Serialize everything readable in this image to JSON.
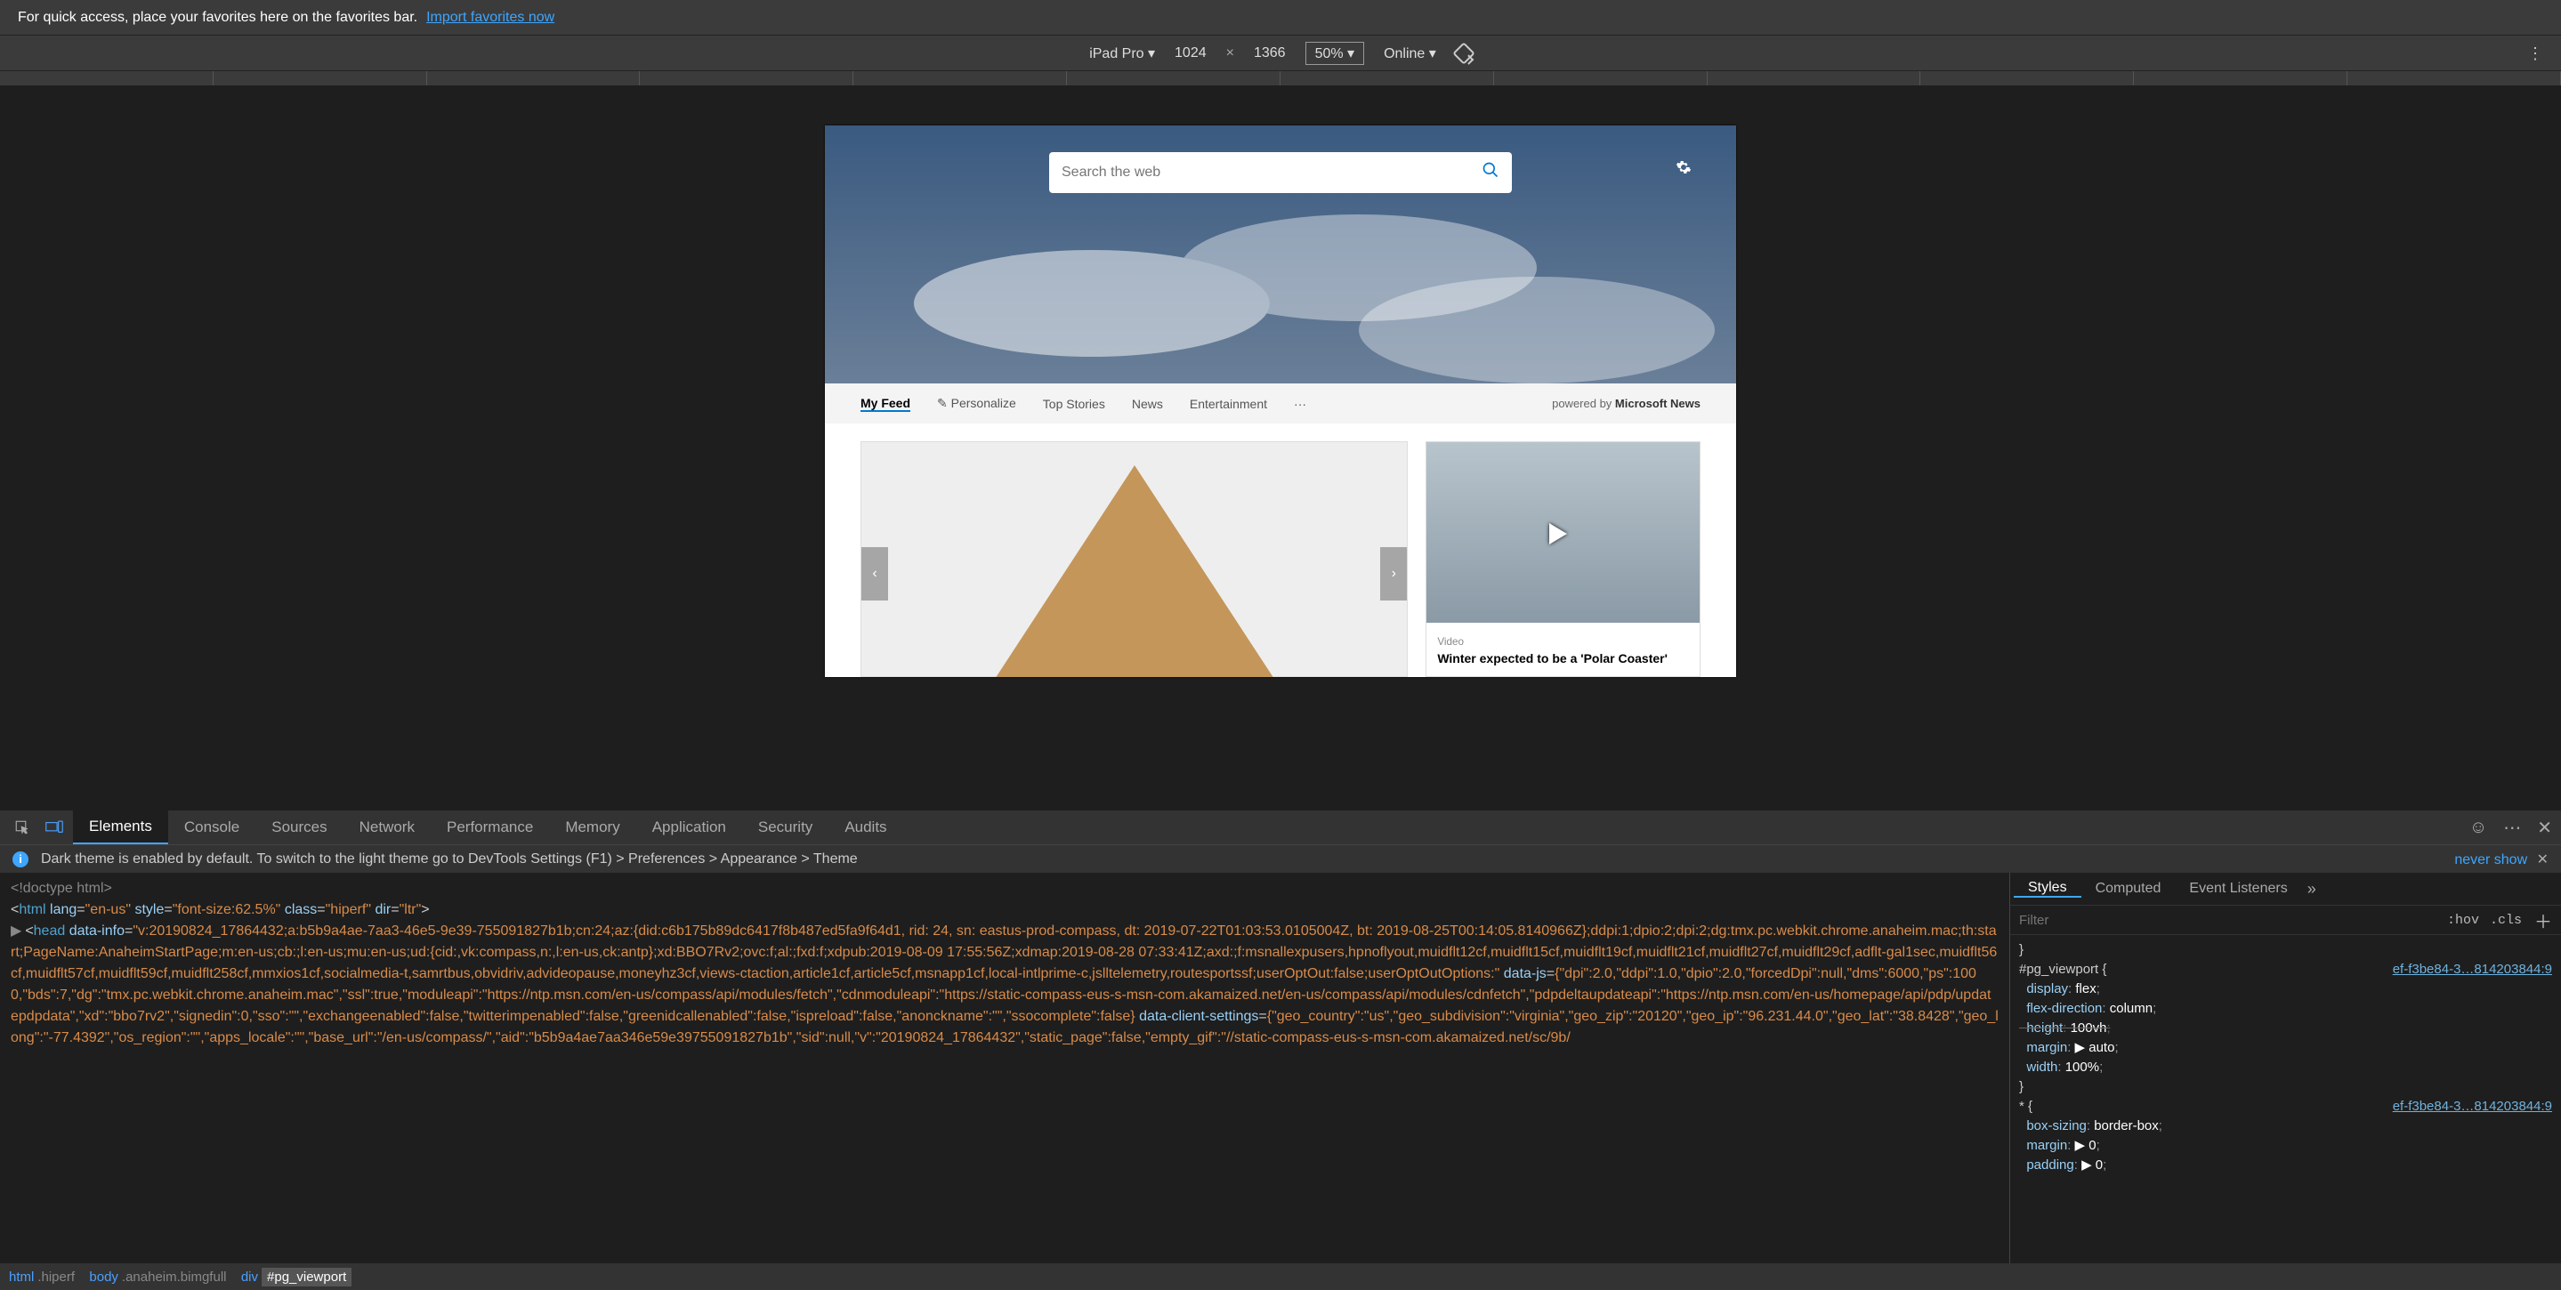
{
  "favorites": {
    "text": "For quick access, place your favorites here on the favorites bar.",
    "link": "Import favorites now"
  },
  "device_toolbar": {
    "device": "iPad Pro ▾",
    "width": "1024",
    "x": "×",
    "height": "1366",
    "zoom": "50% ▾",
    "network": "Online ▾"
  },
  "simulated_page": {
    "search_placeholder": "Search the web",
    "feed_tabs": [
      "My Feed",
      "✎ Personalize",
      "Top Stories",
      "News",
      "Entertainment",
      "···"
    ],
    "powered_by": "powered by ",
    "powered_by_brand": "Microsoft News",
    "video_label": "Video",
    "video_title": "Winter expected to be a 'Polar Coaster'"
  },
  "devtools": {
    "tabs": [
      "Elements",
      "Console",
      "Sources",
      "Network",
      "Performance",
      "Memory",
      "Application",
      "Security",
      "Audits"
    ],
    "info_text": "Dark theme is enabled by default. To switch to the light theme go to DevTools Settings (F1) > Preferences > Appearance > Theme",
    "never_show": "never show",
    "styles_tabs": [
      "Styles",
      "Computed",
      "Event Listeners"
    ],
    "filter_placeholder": "Filter",
    "hov": ":hov",
    "cls": ".cls",
    "rule1_selector": "#pg_viewport {",
    "rule1_source": "ef-f3be84-3…814203844:9",
    "rule1_props": [
      {
        "p": "display",
        "v": "flex"
      },
      {
        "p": "flex-direction",
        "v": "column"
      },
      {
        "p": "height",
        "v": "100vh",
        "strike": true
      },
      {
        "p": "margin",
        "v": "▶ auto",
        "tri": true
      },
      {
        "p": "width",
        "v": "100%"
      }
    ],
    "rule2_selector": "* {",
    "rule2_source": "ef-f3be84-3…814203844:9",
    "rule2_props": [
      {
        "p": "box-sizing",
        "v": "border-box"
      },
      {
        "p": "margin",
        "v": "▶ 0",
        "tri": true
      },
      {
        "p": "padding",
        "v": "▶ 0",
        "tri": true
      }
    ],
    "breadcrumbs": [
      {
        "main": "html",
        "sub": ".hiperf"
      },
      {
        "main": "body",
        "sub": ".anaheim.bimgfull"
      },
      {
        "main": "div",
        "sub": "#pg_viewport",
        "cur": true
      }
    ],
    "dom_lines": {
      "doctype": "<!doctype html>",
      "html_open": "<html lang=\"en-us\" style=\"font-size:62.5%\" class=\"hiperf\" dir=\"ltr\">",
      "head_open_attr": "data-info",
      "data_info_val": "\"v:20190824_17864432;a:b5b9a4ae-7aa3-46e5-9e39-755091827b1b;cn:24;az:{did:c6b175b89dc6417f8b487ed5fa9f64d1, rid: 24, sn: eastus-prod-compass, dt: 2019-07-22T01:03:53.0105004Z, bt: 2019-08-25T00:14:05.8140966Z};ddpi:1;dpio:2;dpi:2;dg:tmx.pc.webkit.chrome.anaheim.mac;th:start;PageName:AnaheimStartPage;m:en-us;cb:;l:en-us;mu:en-us;ud:{cid:,vk:compass,n:,l:en-us,ck:antp};xd:BBO7Rv2;ovc:f;al:;fxd:f;xdpub:2019-08-09 17:55:56Z;xdmap:2019-08-28 07:33:41Z;axd:;f:msnallexpusers,hpnoflyout,muidflt12cf,muidflt15cf,muidflt19cf,muidflt21cf,muidflt27cf,muidflt29cf,adflt-gal1sec,muidflt56cf,muidflt57cf,muidflt59cf,muidflt258cf,mmxios1cf,socialmedia-t,samrtbus,obvidriv,advideopause,moneyhz3cf,views-ctaction,article1cf,article5cf,msnapp1cf,local-intlprime-c,jslltelemetry,routesportssf;userOptOut:false;userOptOutOptions:\"",
      "data_js_attr": "data-js",
      "data_js_val": "{\"dpi\":2.0,\"ddpi\":1.0,\"dpio\":2.0,\"forcedDpi\":null,\"dms\":6000,\"ps\":1000,\"bds\":7,\"dg\":\"tmx.pc.webkit.chrome.anaheim.mac\",\"ssl\":true,\"moduleapi\":\"https://ntp.msn.com/en-us/compass/api/modules/fetch\",\"cdnmoduleapi\":\"https://static-compass-eus-s-msn-com.akamaized.net/en-us/compass/api/modules/cdnfetch\",\"pdpdeltaupdateapi\":\"https://ntp.msn.com/en-us/homepage/api/pdp/updatepdpdata\",\"xd\":\"bbo7rv2\",\"signedin\":0,\"sso\":\"\",\"exchangeenabled\":false,\"twitterimpenabled\":false,\"greenidcallenabled\":false,\"ispreload\":false,\"anonckname\":\"\",\"ssocomplete\":false}",
      "data_client_attr": "data-client-settings",
      "data_client_val": "{\"geo_country\":\"us\",\"geo_subdivision\":\"virginia\",\"geo_zip\":\"20120\",\"geo_ip\":\"96.231.44.0\",\"geo_lat\":\"38.8428\",\"geo_long\":\"-77.4392\",\"os_region\":\"\",\"apps_locale\":\"\",\"base_url\":\"/en-us/compass/\",\"aid\":\"b5b9a4ae7aa346e59e39755091827b1b\",\"sid\":null,\"v\":\"20190824_17864432\",\"static_page\":false,\"empty_gif\":\"//static-compass-eus-s-msn-com.akamaized.net/sc/9b/"
    }
  }
}
